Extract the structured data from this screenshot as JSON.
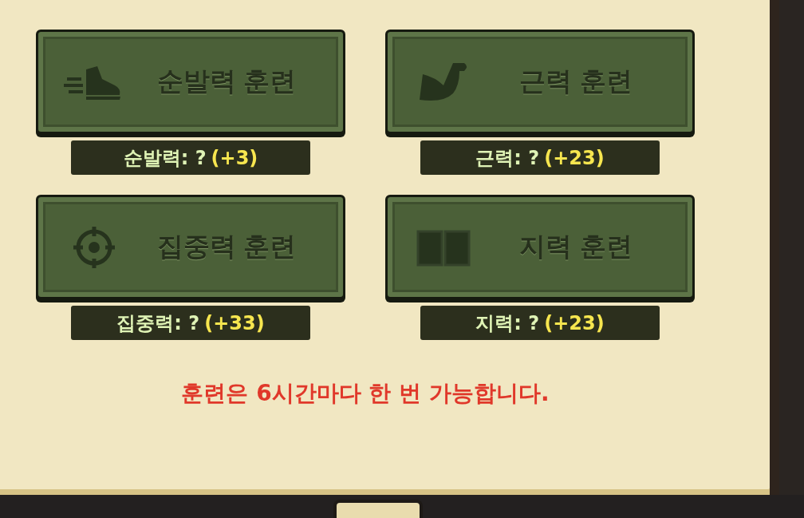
{
  "trainings": [
    {
      "kind": "shoe",
      "label": "순발력 훈련",
      "stat": "순발력: ?",
      "bonus": "(+3)"
    },
    {
      "kind": "arm",
      "label": "근력 훈련",
      "stat": "근력: ?",
      "bonus": "(+23)"
    },
    {
      "kind": "target",
      "label": "집중력 훈련",
      "stat": "집중력: ?",
      "bonus": "(+33)"
    },
    {
      "kind": "book",
      "label": "지력 훈련",
      "stat": "지력: ?",
      "bonus": "(+23)"
    }
  ],
  "notice": "훈련은 6시간마다 한 번 가능합니다."
}
